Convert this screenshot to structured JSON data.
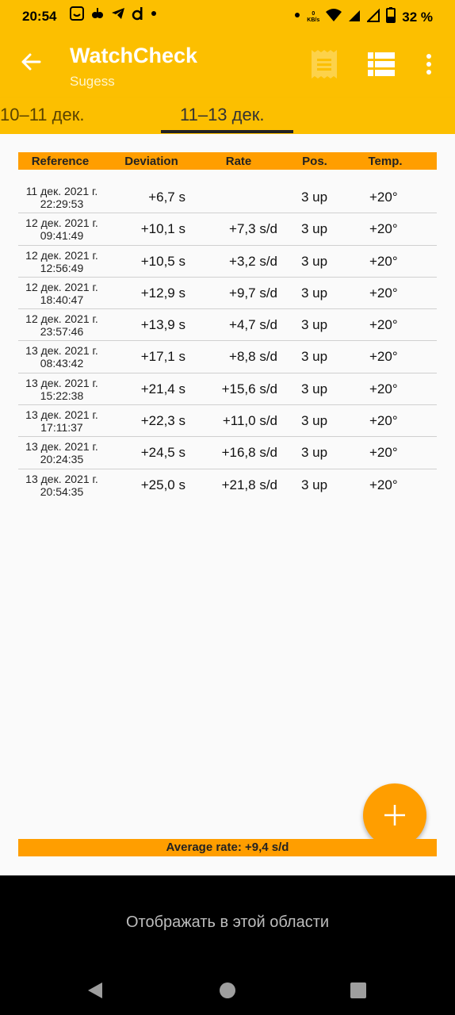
{
  "status": {
    "time": "20:54",
    "net_speed_value": "0",
    "net_speed_unit": "KB/s",
    "battery": "32 %"
  },
  "appbar": {
    "title": "WatchCheck",
    "subtitle": "Sugess"
  },
  "tabs": [
    {
      "label": "10–11 дек."
    },
    {
      "label": "11–13 дек."
    }
  ],
  "table": {
    "headers": [
      "Reference",
      "Deviation",
      "Rate",
      "Pos.",
      "Temp."
    ],
    "rows": [
      {
        "date": "11 дек. 2021 г.",
        "time": "22:29:53",
        "deviation": "+6,7 s",
        "rate": "",
        "pos": "3 up",
        "temp": "+20°"
      },
      {
        "date": "12 дек. 2021 г.",
        "time": "09:41:49",
        "deviation": "+10,1 s",
        "rate": "+7,3 s/d",
        "pos": "3 up",
        "temp": "+20°"
      },
      {
        "date": "12 дек. 2021 г.",
        "time": "12:56:49",
        "deviation": "+10,5 s",
        "rate": "+3,2 s/d",
        "pos": "3 up",
        "temp": "+20°"
      },
      {
        "date": "12 дек. 2021 г.",
        "time": "18:40:47",
        "deviation": "+12,9 s",
        "rate": "+9,7 s/d",
        "pos": "3 up",
        "temp": "+20°"
      },
      {
        "date": "12 дек. 2021 г.",
        "time": "23:57:46",
        "deviation": "+13,9 s",
        "rate": "+4,7 s/d",
        "pos": "3 up",
        "temp": "+20°"
      },
      {
        "date": "13 дек. 2021 г.",
        "time": "08:43:42",
        "deviation": "+17,1 s",
        "rate": "+8,8 s/d",
        "pos": "3 up",
        "temp": "+20°"
      },
      {
        "date": "13 дек. 2021 г.",
        "time": "15:22:38",
        "deviation": "+21,4 s",
        "rate": "+15,6 s/d",
        "pos": "3 up",
        "temp": "+20°"
      },
      {
        "date": "13 дек. 2021 г.",
        "time": "17:11:37",
        "deviation": "+22,3 s",
        "rate": "+11,0 s/d",
        "pos": "3 up",
        "temp": "+20°"
      },
      {
        "date": "13 дек. 2021 г.",
        "time": "20:24:35",
        "deviation": "+24,5 s",
        "rate": "+16,8 s/d",
        "pos": "3 up",
        "temp": "+20°"
      },
      {
        "date": "13 дек. 2021 г.",
        "time": "20:54:35",
        "deviation": "+25,0 s",
        "rate": "+21,8 s/d",
        "pos": "3 up",
        "temp": "+20°"
      }
    ]
  },
  "footer": {
    "average": "Average rate: +9,4 s/d"
  },
  "ad": {
    "text": "Отображать в этой области"
  },
  "icons": {
    "back": "arrow-back-icon",
    "receipt": "receipt-icon",
    "list": "list-view-icon",
    "more": "more-vert-icon",
    "fab": "add-icon"
  },
  "colors": {
    "primary": "#fcbf00",
    "accent": "#ff9e00"
  }
}
